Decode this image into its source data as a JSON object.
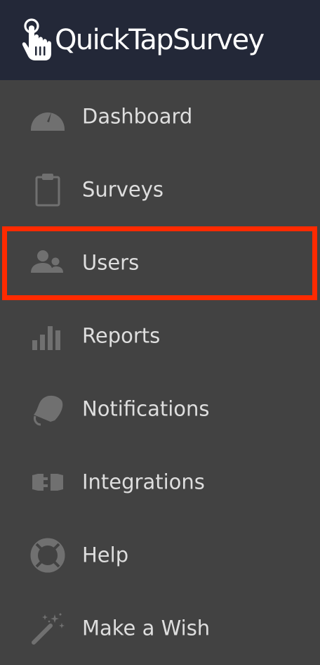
{
  "app": {
    "name": "QuickTapSurvey"
  },
  "colors": {
    "header_bg": "#232838",
    "sidebar_bg": "#424242",
    "icon": "#707070",
    "label": "#dedede",
    "highlight": "#ff2a00"
  },
  "sidebar": {
    "items": [
      {
        "label": "Dashboard",
        "icon": "speedometer-icon"
      },
      {
        "label": "Surveys",
        "icon": "clipboard-icon"
      },
      {
        "label": "Users",
        "icon": "users-icon"
      },
      {
        "label": "Reports",
        "icon": "bar-chart-icon"
      },
      {
        "label": "Notifications",
        "icon": "bell-icon"
      },
      {
        "label": "Integrations",
        "icon": "plug-icon"
      },
      {
        "label": "Help",
        "icon": "lifebuoy-icon"
      },
      {
        "label": "Make a Wish",
        "icon": "magic-wand-icon"
      }
    ]
  }
}
